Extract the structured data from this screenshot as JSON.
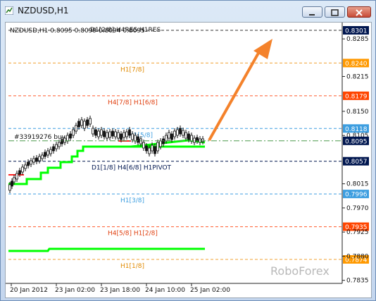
{
  "window": {
    "title": "NZDUSD,H1"
  },
  "chart_header": {
    "symbol_line": "NZDUSD,H1  0.8095 0.8099 0.8094 0.8095"
  },
  "watermark": "RoboForex",
  "order_label": "#33919276 buy",
  "colors": {
    "support_resistance_green": "#00ff00",
    "arrow": "#f4822b",
    "current_price_bg": "#00164f",
    "orange_level": "#ff8000",
    "red_level": "#ff4500",
    "blue_level": "#3d9ee0"
  },
  "levels": [
    {
      "price": 0.8301,
      "label": "D1[2/8] H4RES H1RES",
      "line_color": "#333333",
      "tag_text": "0.8301",
      "tag_bg": "#00164f",
      "label_color": "#222222"
    },
    {
      "price": 0.824,
      "label": "H1[7/8]",
      "line_color": "#f0a030",
      "tag_text": "0.8240",
      "tag_bg": "#ff9900",
      "label_color": "#e08a00"
    },
    {
      "price": 0.8179,
      "label": "H4[7/8] H1[6/8]",
      "line_color": "#ff5a2b",
      "tag_text": "0.8179",
      "tag_bg": "#ff4500",
      "label_color": "#e04010"
    },
    {
      "price": 0.8118,
      "label": "H1[5/8]",
      "line_color": "#3d9ee0",
      "tag_text": "0.8118",
      "tag_bg": "#3d9ee0",
      "label_color": "#3d9ee0"
    },
    {
      "price": 0.8057,
      "label": "D1[1/8] H4[6/8] H1PIVOT",
      "line_color": "#00164f",
      "tag_text": "0.8057",
      "tag_bg": "#00164f",
      "label_color": "#00164f"
    },
    {
      "price": 0.7996,
      "label": "H1[3/8]",
      "line_color": "#3d9ee0",
      "tag_text": "0.7996",
      "tag_bg": "#3d9ee0",
      "label_color": "#3d9ee0"
    },
    {
      "price": 0.7935,
      "label": "H4[5/8] H1[2/8]",
      "line_color": "#ff5a2b",
      "tag_text": "0.7935",
      "tag_bg": "#ff4500",
      "label_color": "#e04010"
    },
    {
      "price": 0.7874,
      "label": "H1[1/8]",
      "line_color": "#f0a030",
      "tag_text": "0.7874",
      "tag_bg": "#ff9900",
      "label_color": "#e08a00"
    }
  ],
  "current_price": {
    "price": 0.8095,
    "tag_text": "0.8095"
  },
  "y_axis": {
    "ticks": [
      "0.8285",
      "0.8215",
      "0.8150",
      "0.8105",
      "0.8015",
      "0.7970",
      "0.7925",
      "0.7880",
      "0.7835"
    ],
    "tick_prices": [
      0.8285,
      0.8215,
      0.815,
      0.8105,
      0.8015,
      0.797,
      0.7925,
      0.788,
      0.7835
    ]
  },
  "x_axis": {
    "ticks": [
      "20 Jan 2012",
      "23 Jan 02:00",
      "23 Jan 18:00",
      "24 Jan 10:00",
      "25 Jan 02:00"
    ]
  }
}
